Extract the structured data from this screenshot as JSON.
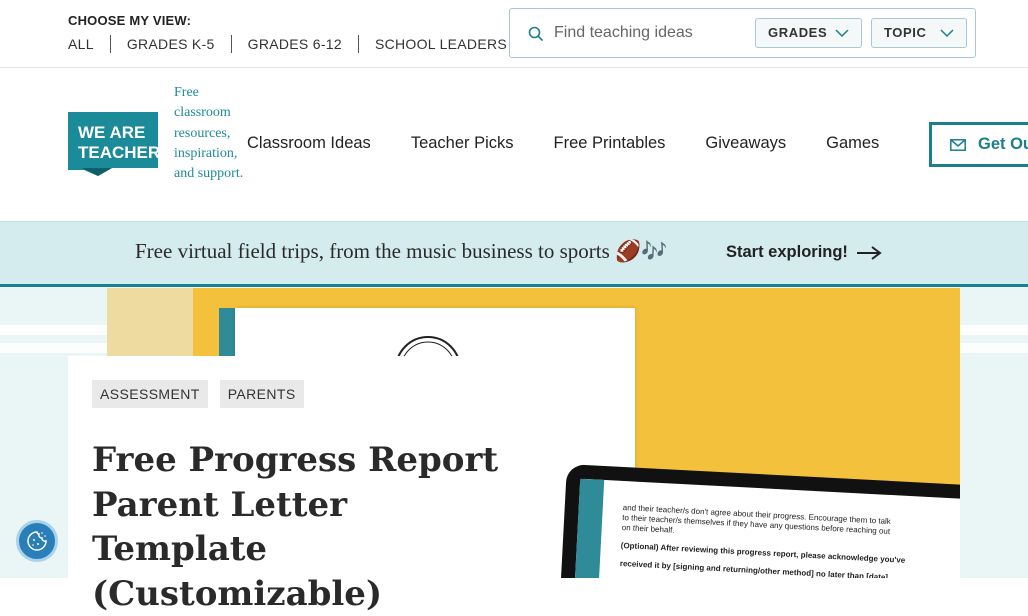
{
  "topbar": {
    "choose_label": "CHOOSE MY VIEW:",
    "views": [
      "ALL",
      "GRADES K-5",
      "GRADES 6-12",
      "SCHOOL LEADERS"
    ]
  },
  "search": {
    "placeholder": "Find teaching ideas",
    "grades_label": "GRADES",
    "topic_label": "TOPIC"
  },
  "header": {
    "logo_text_line1": "WE ARE",
    "logo_text_line2": "TEACHERS",
    "tagline": "Free classroom resources, inspiration, and support.",
    "nav": [
      "Classroom Ideas",
      "Teacher Picks",
      "Free Printables",
      "Giveaways",
      "Games"
    ],
    "cta_label": "Get Ou"
  },
  "banner": {
    "text": "Free virtual field trips, from the music business to sports 🏈🎶",
    "cta": "Start exploring!"
  },
  "article": {
    "tags": [
      "ASSESSMENT",
      "PARENTS"
    ],
    "title": "Free Progress Report Parent Letter Template (Customizable)"
  },
  "hero_preview": {
    "line1": "and their teacher/s don't agree about their progress. Encourage them to talk",
    "line2": "to their teacher/s themselves if they have any questions before reaching out",
    "line3": "on their behalf.",
    "line4": "(Optional) After reviewing this progress report, please acknowledge you've",
    "line5": "received it by [signing and returning/other method] no later than [date]."
  },
  "colors": {
    "brand_teal": "#1b7f8e",
    "banner_bg": "#d5ecef",
    "hero_yellow": "#f4c13d"
  }
}
